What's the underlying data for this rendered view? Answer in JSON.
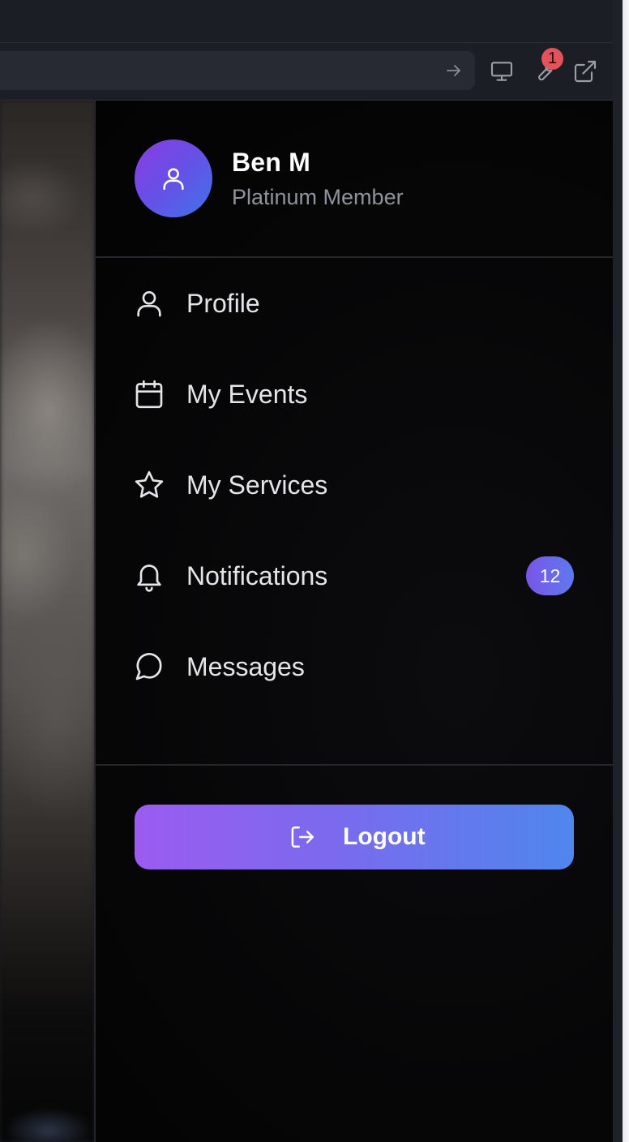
{
  "browser": {
    "extension_badge_count": "1",
    "icons": [
      "arrow-right-icon",
      "monitor-icon",
      "wrench-icon",
      "external-link-icon"
    ]
  },
  "drawer": {
    "user": {
      "name": "Ben M",
      "tier": "Platinum Member",
      "avatar_icon": "user-icon"
    },
    "menu": [
      {
        "label": "Profile",
        "icon": "user-icon"
      },
      {
        "label": "My Events",
        "icon": "calendar-icon"
      },
      {
        "label": "My Services",
        "icon": "star-icon"
      },
      {
        "label": "Notifications",
        "icon": "bell-icon",
        "badge": "12"
      },
      {
        "label": "Messages",
        "icon": "message-circle-icon"
      }
    ],
    "logout": {
      "label": "Logout",
      "icon": "logout-icon"
    }
  },
  "colors": {
    "accent_start": "#9b5cf0",
    "accent_end": "#4f86ed",
    "badge_red": "#e5535a",
    "drawer_bg": "#050505"
  }
}
